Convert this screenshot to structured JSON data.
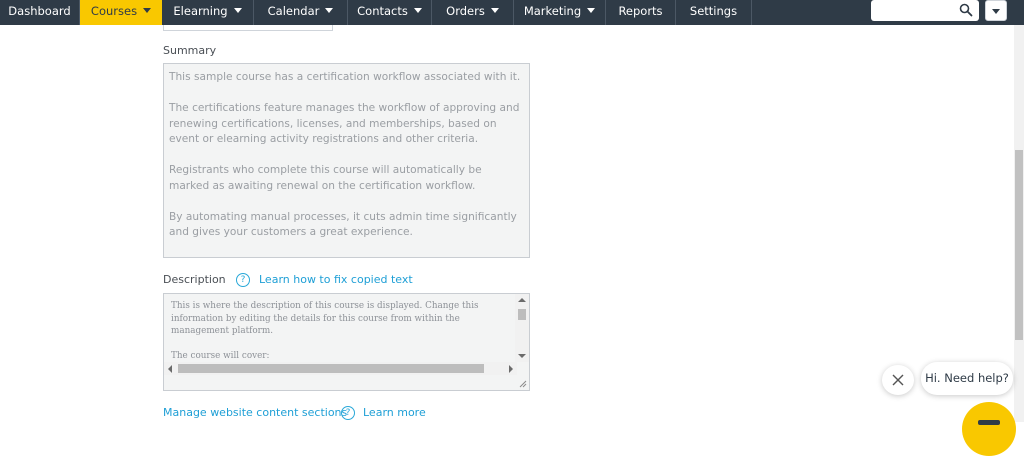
{
  "nav": {
    "items": [
      {
        "label": "Dashboard",
        "dropdown": false
      },
      {
        "label": "Courses",
        "dropdown": true,
        "active": true
      },
      {
        "label": "Elearning",
        "dropdown": true
      },
      {
        "label": "Calendar",
        "dropdown": true
      },
      {
        "label": "Contacts",
        "dropdown": true
      },
      {
        "label": "Orders",
        "dropdown": true
      },
      {
        "label": "Marketing",
        "dropdown": true
      },
      {
        "label": "Reports",
        "dropdown": false
      },
      {
        "label": "Settings",
        "dropdown": false
      }
    ],
    "search": {
      "placeholder": "",
      "value": ""
    },
    "colors": {
      "bar": "#2f3b47",
      "active": "#f9c800"
    }
  },
  "summary": {
    "label": "Summary",
    "paragraphs": [
      "This sample course has a certification workflow associated with it.",
      "The certifications feature manages the workflow of approving and renewing certifications, licenses, and memberships, based on event or elearning activity registrations and other criteria.",
      "Registrants who complete this course will automatically be marked as awaiting renewal on the certification workflow.",
      "By automating manual processes, it cuts admin time significantly and gives your customers a great experience."
    ]
  },
  "description": {
    "label": "Description",
    "help_link": "Learn how to fix copied text",
    "paragraphs": [
      "This is where the description of this course is displayed. Change this information by editing the details for this course from within the management platform.",
      "The course will cover:"
    ]
  },
  "footer_links": {
    "manage": "Manage website content sections",
    "learn_more": "Learn more"
  },
  "chat": {
    "prompt": "Hi. Need help?"
  }
}
